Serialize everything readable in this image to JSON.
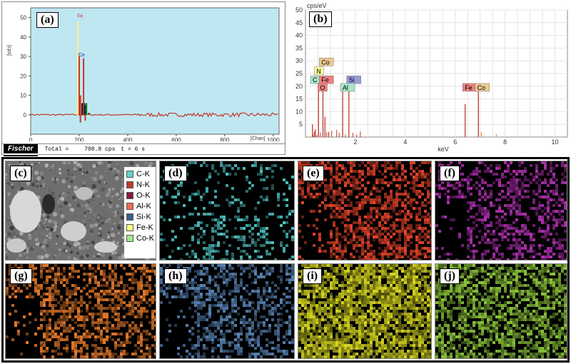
{
  "panels": {
    "a": "(a)",
    "b": "(b)",
    "c": "(c)",
    "d": "(d)",
    "e": "(e)",
    "f": "(f)",
    "g": "(g)",
    "h": "(h)",
    "i": "(i)",
    "j": "(j)"
  },
  "spectrum_a": {
    "ylabel": "[cps]",
    "xlabel": "[Chan]",
    "brand": "Fischer",
    "total_text": "Total =",
    "total_value": "708.8 cps",
    "time_text": "t = 6 s",
    "peak_labels": [
      "Fe",
      "Co"
    ]
  },
  "spectrum_b": {
    "ylabel": "cps/eV",
    "xlabel": "keV",
    "element_tags": [
      {
        "label": "C",
        "color": "#a8e6c8"
      },
      {
        "label": "N",
        "color": "#ffff99"
      },
      {
        "label": "Co",
        "color": "#f0c890"
      },
      {
        "label": "Fe",
        "color": "#f08080"
      },
      {
        "label": "O",
        "color": "#f08080"
      },
      {
        "label": "Si",
        "color": "#9999dd"
      },
      {
        "label": "Al",
        "color": "#a8e6c8"
      },
      {
        "label": "Fe",
        "color": "#f08080"
      },
      {
        "label": "Co",
        "color": "#f0c890"
      }
    ]
  },
  "legend_c": [
    {
      "label": "C-K",
      "color": "#5fd3c8"
    },
    {
      "label": "N-K",
      "color": "#c0392b"
    },
    {
      "label": "O-K",
      "color": "#8b1a3a"
    },
    {
      "label": "Al-K",
      "color": "#e87050"
    },
    {
      "label": "Si-K",
      "color": "#3a5f8a"
    },
    {
      "label": "Fe-K",
      "color": "#ffff80"
    },
    {
      "label": "Co-K",
      "color": "#a6e88a"
    }
  ],
  "map_colors": {
    "d": "#4fc3c3",
    "e": "#e8442a",
    "f": "#b030b0",
    "g": "#e87a2a",
    "h": "#5a86b8",
    "i": "#d8d820",
    "j": "#8cc63a"
  },
  "chart_data": [
    {
      "type": "line",
      "title": "",
      "xlabel": "[Chan]",
      "ylabel": "[cps]",
      "xlim": [
        0,
        1024
      ],
      "ylim": [
        -10,
        55
      ],
      "xticks": [
        0,
        200,
        400,
        600,
        800,
        1000
      ],
      "yticks": [
        0,
        10,
        20,
        30,
        40,
        50
      ],
      "series": [
        {
          "name": "",
          "x": [
            190,
            195,
            200,
            205,
            212,
            218,
            222,
            226,
            230,
            240
          ],
          "y": [
            2,
            48,
            30,
            10,
            6,
            29,
            6,
            5,
            6,
            1
          ]
        }
      ],
      "grid": false
    },
    {
      "type": "line",
      "title": "",
      "xlabel": "keV",
      "ylabel": "cps/eV",
      "xlim": [
        0,
        10.5
      ],
      "ylim": [
        0,
        50
      ],
      "xticks": [
        2,
        4,
        6,
        8,
        10
      ],
      "yticks": [
        5,
        10,
        15,
        20,
        25,
        30,
        35,
        40,
        45,
        50
      ],
      "series": [
        {
          "name": "",
          "x": [
            0.28,
            0.39,
            0.52,
            0.7,
            0.78,
            0.93,
            1.49,
            1.74,
            6.4,
            6.93,
            7.05,
            7.65
          ],
          "y": [
            5,
            3,
            21,
            20,
            8,
            2,
            19,
            19,
            13,
            19,
            2,
            1.2
          ]
        }
      ],
      "grid": true
    }
  ]
}
